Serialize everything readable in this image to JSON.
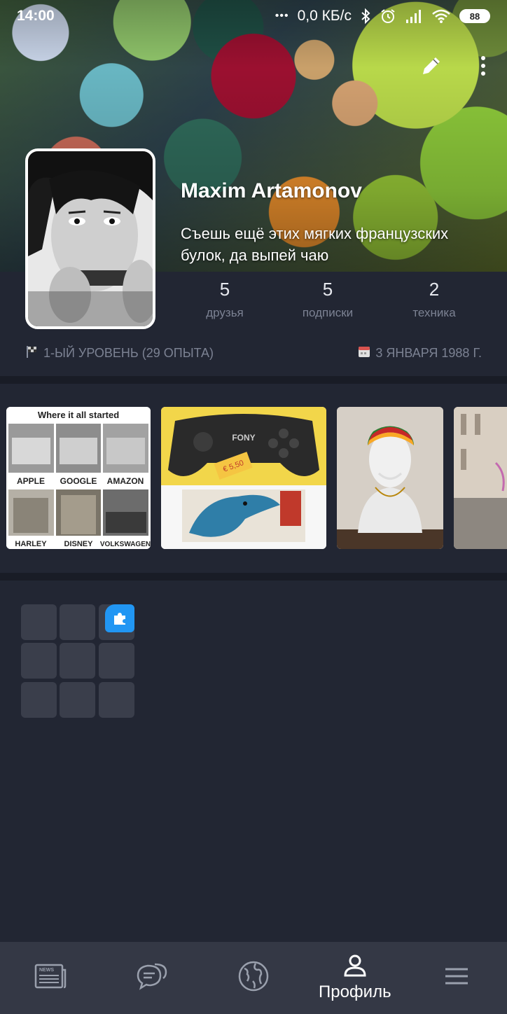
{
  "status_bar": {
    "time": "14:00",
    "dots": "•••",
    "network_speed": "0,0 КБ/с",
    "battery": "88"
  },
  "profile": {
    "name": "Maxim Artamonov",
    "status": "Съешь ещё этих мягких французских булок, да выпей чаю",
    "stats": [
      {
        "value": "5",
        "label": "друзья"
      },
      {
        "value": "5",
        "label": "подписки"
      },
      {
        "value": "2",
        "label": "техника"
      }
    ],
    "level": "1-ЫЙ УРОВЕНЬ (29 ОПЫТА)",
    "birthday": "3 ЯНВАРЯ 1988 Г."
  },
  "photos": {
    "p1": {
      "title": "Where it all started",
      "row1": [
        "APPLE",
        "GOOGLE",
        "AMAZON"
      ],
      "row2": [
        "HARLEY",
        "DISNEY",
        "VOLKSWAGEN"
      ]
    },
    "p2": {
      "brand": "FONY",
      "price": "€ 5,50"
    }
  },
  "bottom_nav": {
    "active_label": "Профиль",
    "items": [
      "news-icon",
      "chat-icon",
      "globe-icon",
      "profile-icon",
      "menu-icon"
    ]
  },
  "colors": {
    "background": "#222633",
    "nav_background": "#343845",
    "accent": "#2196f3",
    "muted_text": "#7c8293"
  }
}
